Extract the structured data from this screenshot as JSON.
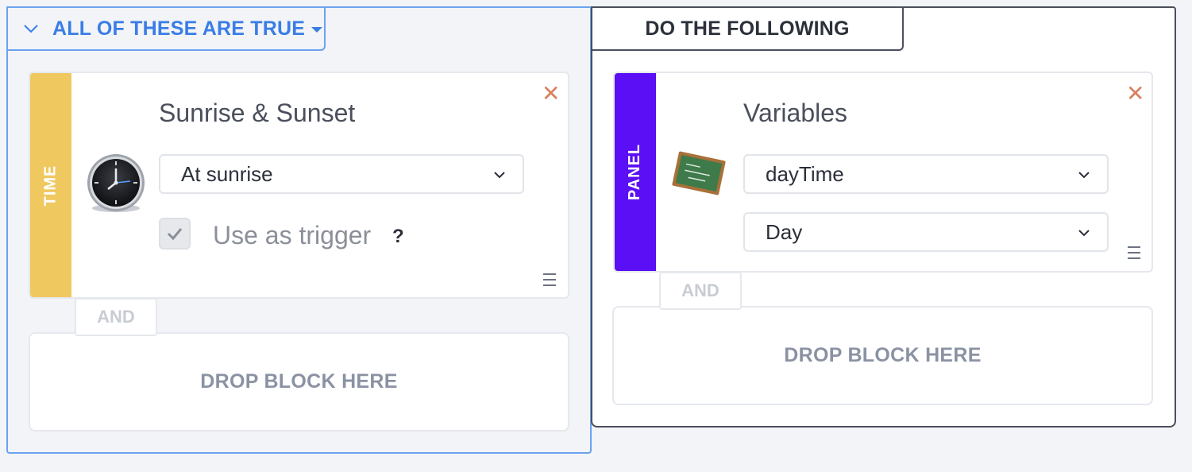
{
  "conditions": {
    "header_label": "ALL OF THESE ARE TRUE",
    "block": {
      "category": "TIME",
      "category_color": "#f0c860",
      "title": "Sunrise & Sunset",
      "icon": "clock-icon",
      "select_value": "At sunrise",
      "trigger_checked": true,
      "trigger_label": "Use as trigger",
      "help": "?"
    },
    "and_label": "AND",
    "drop_label": "DROP BLOCK HERE"
  },
  "actions": {
    "header_label": "DO THE FOLLOWING",
    "block": {
      "category": "PANEL",
      "category_color": "#5a0ff5",
      "title": "Variables",
      "icon": "chalkboard-icon",
      "variable_value": "dayTime",
      "value_value": "Day"
    },
    "and_label": "AND",
    "drop_label": "DROP BLOCK HERE"
  },
  "colors": {
    "accent_blue": "#3a7de6",
    "close_red": "#d9805f",
    "action_border": "#4a4f5c"
  }
}
